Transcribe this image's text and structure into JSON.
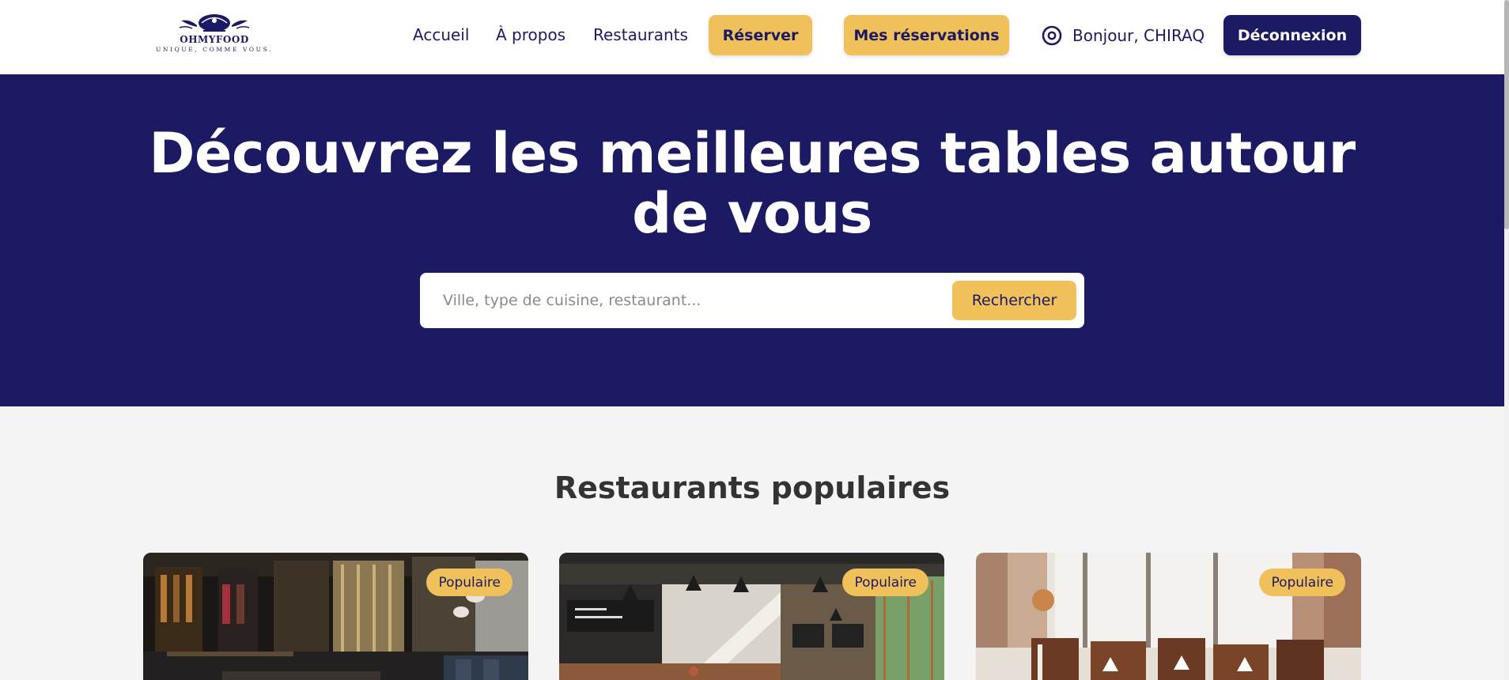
{
  "logo": {
    "name": "OHMYFOOD",
    "tagline": "UNIQUE, COMME VOUS."
  },
  "nav": {
    "home": "Accueil",
    "about": "À propos",
    "restaurants": "Restaurants",
    "book": "Réserver",
    "my_bookings": "Mes réservations",
    "greeting": "Bonjour, CHIRAQ",
    "logout": "Déconnexion"
  },
  "hero": {
    "title": "Découvrez les meilleures tables autour de vous",
    "search_placeholder": "Ville, type de cuisine, restaurant...",
    "search_button": "Rechercher"
  },
  "popular": {
    "title": "Restaurants populaires",
    "cards": [
      {
        "badge": "Populaire"
      },
      {
        "badge": "Populaire"
      },
      {
        "badge": "Populaire"
      }
    ]
  },
  "colors": {
    "primary": "#1c1a63",
    "accent": "#f0c05a",
    "background": "#f4f4f4"
  },
  "icons": {
    "user": "target-circle-icon"
  }
}
